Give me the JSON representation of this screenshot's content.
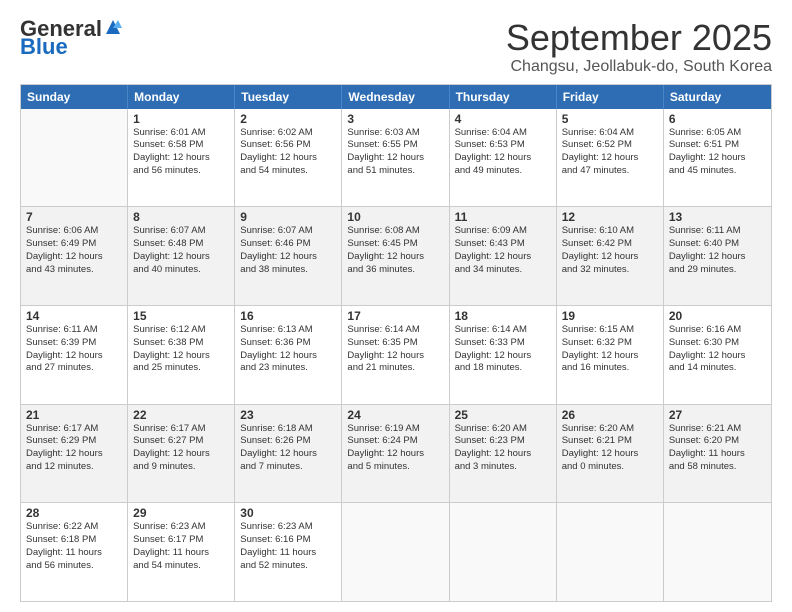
{
  "logo": {
    "general": "General",
    "blue": "Blue"
  },
  "header": {
    "month": "September 2025",
    "location": "Changsu, Jeollabuk-do, South Korea"
  },
  "weekdays": [
    "Sunday",
    "Monday",
    "Tuesday",
    "Wednesday",
    "Thursday",
    "Friday",
    "Saturday"
  ],
  "weeks": [
    [
      {
        "day": "",
        "info": ""
      },
      {
        "day": "1",
        "info": "Sunrise: 6:01 AM\nSunset: 6:58 PM\nDaylight: 12 hours\nand 56 minutes."
      },
      {
        "day": "2",
        "info": "Sunrise: 6:02 AM\nSunset: 6:56 PM\nDaylight: 12 hours\nand 54 minutes."
      },
      {
        "day": "3",
        "info": "Sunrise: 6:03 AM\nSunset: 6:55 PM\nDaylight: 12 hours\nand 51 minutes."
      },
      {
        "day": "4",
        "info": "Sunrise: 6:04 AM\nSunset: 6:53 PM\nDaylight: 12 hours\nand 49 minutes."
      },
      {
        "day": "5",
        "info": "Sunrise: 6:04 AM\nSunset: 6:52 PM\nDaylight: 12 hours\nand 47 minutes."
      },
      {
        "day": "6",
        "info": "Sunrise: 6:05 AM\nSunset: 6:51 PM\nDaylight: 12 hours\nand 45 minutes."
      }
    ],
    [
      {
        "day": "7",
        "info": "Sunrise: 6:06 AM\nSunset: 6:49 PM\nDaylight: 12 hours\nand 43 minutes."
      },
      {
        "day": "8",
        "info": "Sunrise: 6:07 AM\nSunset: 6:48 PM\nDaylight: 12 hours\nand 40 minutes."
      },
      {
        "day": "9",
        "info": "Sunrise: 6:07 AM\nSunset: 6:46 PM\nDaylight: 12 hours\nand 38 minutes."
      },
      {
        "day": "10",
        "info": "Sunrise: 6:08 AM\nSunset: 6:45 PM\nDaylight: 12 hours\nand 36 minutes."
      },
      {
        "day": "11",
        "info": "Sunrise: 6:09 AM\nSunset: 6:43 PM\nDaylight: 12 hours\nand 34 minutes."
      },
      {
        "day": "12",
        "info": "Sunrise: 6:10 AM\nSunset: 6:42 PM\nDaylight: 12 hours\nand 32 minutes."
      },
      {
        "day": "13",
        "info": "Sunrise: 6:11 AM\nSunset: 6:40 PM\nDaylight: 12 hours\nand 29 minutes."
      }
    ],
    [
      {
        "day": "14",
        "info": "Sunrise: 6:11 AM\nSunset: 6:39 PM\nDaylight: 12 hours\nand 27 minutes."
      },
      {
        "day": "15",
        "info": "Sunrise: 6:12 AM\nSunset: 6:38 PM\nDaylight: 12 hours\nand 25 minutes."
      },
      {
        "day": "16",
        "info": "Sunrise: 6:13 AM\nSunset: 6:36 PM\nDaylight: 12 hours\nand 23 minutes."
      },
      {
        "day": "17",
        "info": "Sunrise: 6:14 AM\nSunset: 6:35 PM\nDaylight: 12 hours\nand 21 minutes."
      },
      {
        "day": "18",
        "info": "Sunrise: 6:14 AM\nSunset: 6:33 PM\nDaylight: 12 hours\nand 18 minutes."
      },
      {
        "day": "19",
        "info": "Sunrise: 6:15 AM\nSunset: 6:32 PM\nDaylight: 12 hours\nand 16 minutes."
      },
      {
        "day": "20",
        "info": "Sunrise: 6:16 AM\nSunset: 6:30 PM\nDaylight: 12 hours\nand 14 minutes."
      }
    ],
    [
      {
        "day": "21",
        "info": "Sunrise: 6:17 AM\nSunset: 6:29 PM\nDaylight: 12 hours\nand 12 minutes."
      },
      {
        "day": "22",
        "info": "Sunrise: 6:17 AM\nSunset: 6:27 PM\nDaylight: 12 hours\nand 9 minutes."
      },
      {
        "day": "23",
        "info": "Sunrise: 6:18 AM\nSunset: 6:26 PM\nDaylight: 12 hours\nand 7 minutes."
      },
      {
        "day": "24",
        "info": "Sunrise: 6:19 AM\nSunset: 6:24 PM\nDaylight: 12 hours\nand 5 minutes."
      },
      {
        "day": "25",
        "info": "Sunrise: 6:20 AM\nSunset: 6:23 PM\nDaylight: 12 hours\nand 3 minutes."
      },
      {
        "day": "26",
        "info": "Sunrise: 6:20 AM\nSunset: 6:21 PM\nDaylight: 12 hours\nand 0 minutes."
      },
      {
        "day": "27",
        "info": "Sunrise: 6:21 AM\nSunset: 6:20 PM\nDaylight: 11 hours\nand 58 minutes."
      }
    ],
    [
      {
        "day": "28",
        "info": "Sunrise: 6:22 AM\nSunset: 6:18 PM\nDaylight: 11 hours\nand 56 minutes."
      },
      {
        "day": "29",
        "info": "Sunrise: 6:23 AM\nSunset: 6:17 PM\nDaylight: 11 hours\nand 54 minutes."
      },
      {
        "day": "30",
        "info": "Sunrise: 6:23 AM\nSunset: 6:16 PM\nDaylight: 11 hours\nand 52 minutes."
      },
      {
        "day": "",
        "info": ""
      },
      {
        "day": "",
        "info": ""
      },
      {
        "day": "",
        "info": ""
      },
      {
        "day": "",
        "info": ""
      }
    ]
  ]
}
